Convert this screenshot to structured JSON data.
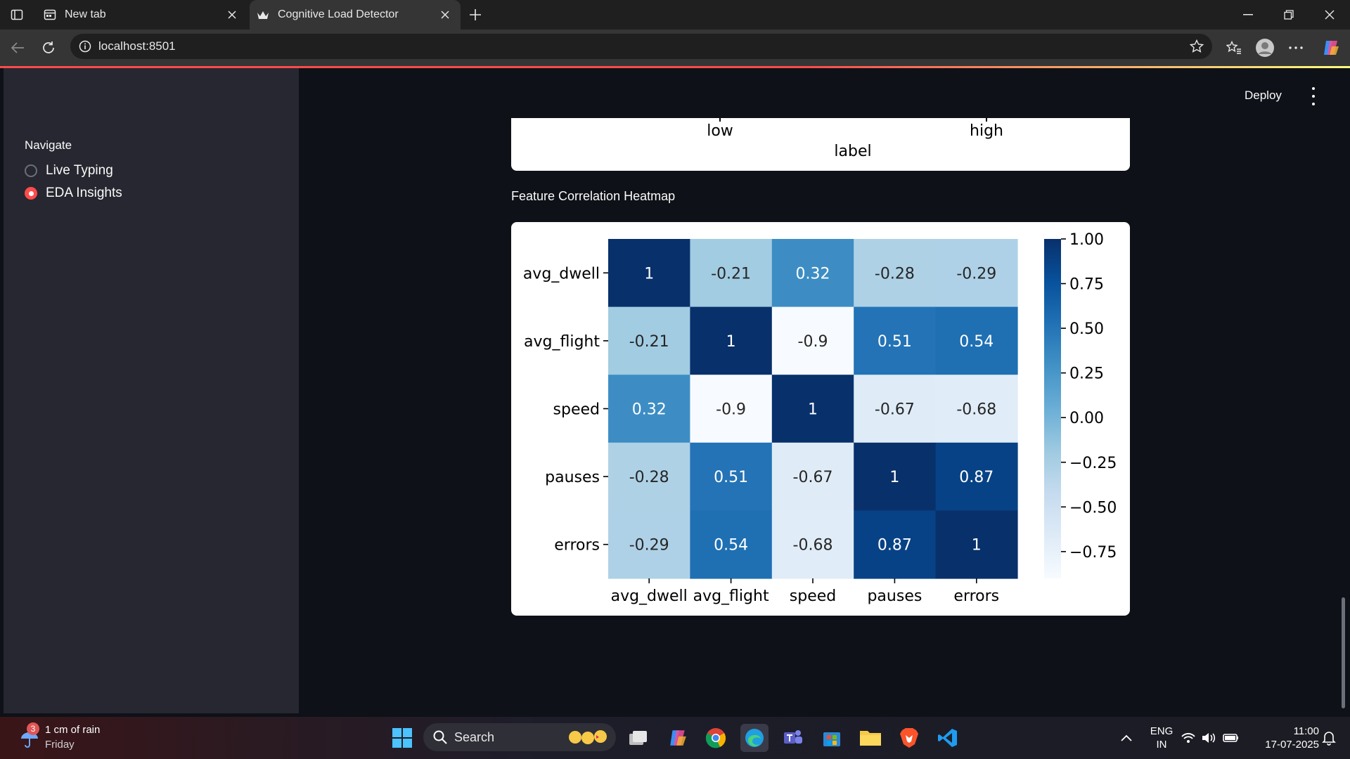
{
  "browser": {
    "tabs": [
      {
        "title": "New tab"
      },
      {
        "title": "Cognitive Load Detector"
      }
    ],
    "url": "localhost:8501"
  },
  "sidebar": {
    "title": "Navigate",
    "options": [
      {
        "label": "Live Typing",
        "selected": false
      },
      {
        "label": "EDA Insights",
        "selected": true
      }
    ]
  },
  "header": {
    "deploy_label": "Deploy"
  },
  "previous_chart": {
    "xtick_labels": [
      "low",
      "high"
    ],
    "xlabel": "label"
  },
  "heatmap": {
    "section_title": "Feature Correlation Heatmap"
  },
  "chart_data": {
    "type": "heatmap",
    "title": "",
    "rows": [
      "avg_dwell",
      "avg_flight",
      "speed",
      "pauses",
      "errors"
    ],
    "columns": [
      "avg_dwell",
      "avg_flight",
      "speed",
      "pauses",
      "errors"
    ],
    "values": [
      [
        1,
        -0.21,
        0.32,
        -0.28,
        -0.29
      ],
      [
        -0.21,
        1,
        -0.9,
        0.51,
        0.54
      ],
      [
        0.32,
        -0.9,
        1,
        -0.67,
        -0.68
      ],
      [
        -0.28,
        0.51,
        -0.67,
        1,
        0.87
      ],
      [
        -0.29,
        0.54,
        -0.68,
        0.87,
        1
      ]
    ],
    "value_labels": [
      [
        "1",
        "-0.21",
        "0.32",
        "-0.28",
        "-0.29"
      ],
      [
        "-0.21",
        "1",
        "-0.9",
        "0.51",
        "0.54"
      ],
      [
        "0.32",
        "-0.9",
        "1",
        "-0.67",
        "-0.68"
      ],
      [
        "-0.28",
        "0.51",
        "-0.67",
        "1",
        "0.87"
      ],
      [
        "-0.29",
        "0.54",
        "-0.68",
        "0.87",
        "1"
      ]
    ],
    "colormap": "Blues",
    "colorbar": {
      "range": [
        -0.9,
        1
      ],
      "ticks": [
        1.0,
        0.75,
        0.5,
        0.25,
        0.0,
        -0.25,
        -0.5,
        -0.75
      ],
      "tick_labels": [
        "1.00",
        "0.75",
        "0.50",
        "0.25",
        "0.00",
        "−0.25",
        "−0.50",
        "−0.75"
      ]
    }
  },
  "taskbar": {
    "weather": {
      "badge": "3",
      "line1": "1 cm of rain",
      "line2": "Friday"
    },
    "search_label": "Search",
    "language": {
      "line1": "ENG",
      "line2": "IN"
    },
    "clock": {
      "time": "11:00",
      "date": "17-07-2025"
    }
  }
}
